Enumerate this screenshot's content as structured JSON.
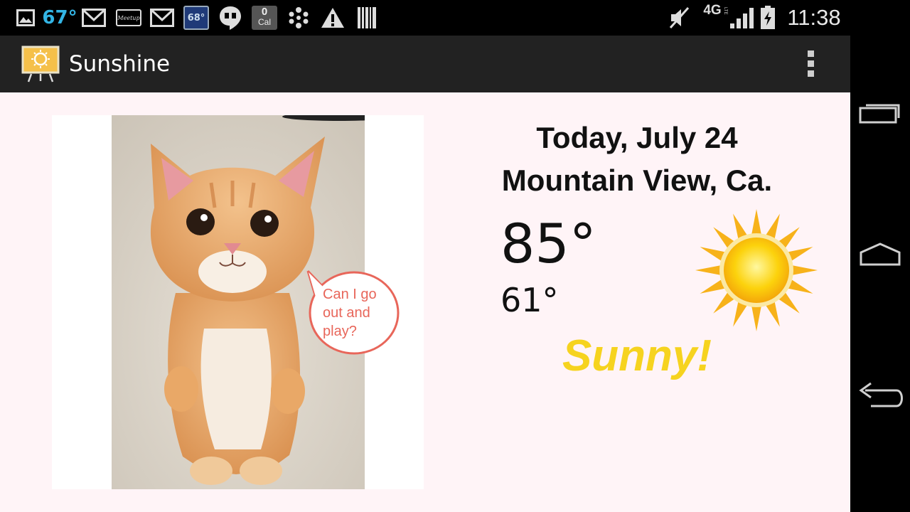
{
  "status_bar": {
    "weather_temp": "67°",
    "weather_badge": "68°",
    "calendar_count": "0",
    "calendar_label": "Cal",
    "meetup_label": "Meetup",
    "network": "4G",
    "network_sub": "LTE",
    "time": "11:38",
    "icons": [
      "image-icon",
      "gmail-icon",
      "meetup-icon",
      "gmail-icon",
      "weather-badge-icon",
      "hangouts-icon",
      "calendar-icon",
      "dots-icon",
      "warning-icon",
      "barcode-icon",
      "mute-icon",
      "signal-icon",
      "battery-icon"
    ]
  },
  "action_bar": {
    "title": "Sunshine",
    "icon": "sunshine-app-icon",
    "overflow_icon": "overflow-menu-icon"
  },
  "weather": {
    "date": "Today, July 24",
    "location": "Mountain View, Ca.",
    "high": "85°",
    "low": "61°",
    "condition": "Sunny!",
    "condition_color": "#f6d31f",
    "icon": "sun-icon"
  },
  "photo": {
    "speech_bubble": [
      "Can I go",
      "out and",
      "play?"
    ],
    "bubble_color": "#e8665a"
  },
  "nav_bar": {
    "buttons": [
      "recent-apps-icon",
      "home-icon",
      "back-icon"
    ]
  }
}
